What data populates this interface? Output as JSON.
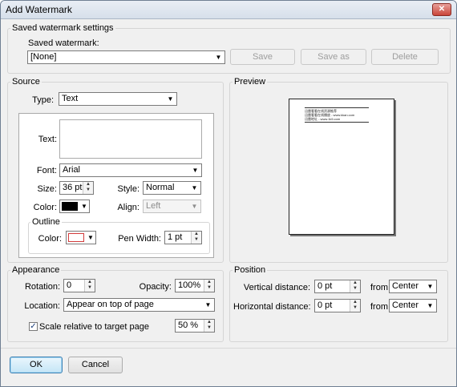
{
  "window": {
    "title": "Add Watermark",
    "close_glyph": "✕"
  },
  "saved": {
    "group_label": "Saved watermark settings",
    "label": "Saved watermark:",
    "value": "[None]",
    "save_label": "Save",
    "save_as_label": "Save as",
    "delete_label": "Delete"
  },
  "source": {
    "group_label": "Source",
    "type_label": "Type:",
    "type_value": "Text",
    "text_label": "Text:",
    "text_value": "",
    "font_label": "Font:",
    "font_value": "Arial",
    "size_label": "Size:",
    "size_value": "36 pt",
    "style_label": "Style:",
    "style_value": "Normal",
    "color_label": "Color:",
    "color_value": "#000000",
    "align_label": "Align:",
    "align_value": "Left",
    "outline": {
      "label": "Outline",
      "color_label": "Color:",
      "color_value": "#ffffff",
      "color_border": "#d23b3b",
      "pen_label": "Pen Width:",
      "pen_value": "1 pt"
    }
  },
  "preview": {
    "group_label": "Preview",
    "lines": [
      "迅雷看看在线资源推荐",
      "迅雷看看在线播放 - www.kkan.com",
      "迅雷地址 - www.1k5.com"
    ]
  },
  "appearance": {
    "group_label": "Appearance",
    "rotation_label": "Rotation:",
    "rotation_value": "0",
    "opacity_label": "Opacity:",
    "opacity_value": "100%",
    "location_label": "Location:",
    "location_value": "Appear on top of page",
    "scale_label": "Scale relative to target page",
    "scale_checked": true,
    "scale_value": "50 %"
  },
  "position": {
    "group_label": "Position",
    "vertical_label": "Vertical distance:",
    "vertical_value": "0 pt",
    "vertical_from_label": "from",
    "vertical_from_value": "Center",
    "horizontal_label": "Horizontal distance:",
    "horizontal_value": "0 pt",
    "horizontal_from_label": "from",
    "horizontal_from_value": "Center"
  },
  "footer": {
    "ok_label": "OK",
    "cancel_label": "Cancel"
  }
}
